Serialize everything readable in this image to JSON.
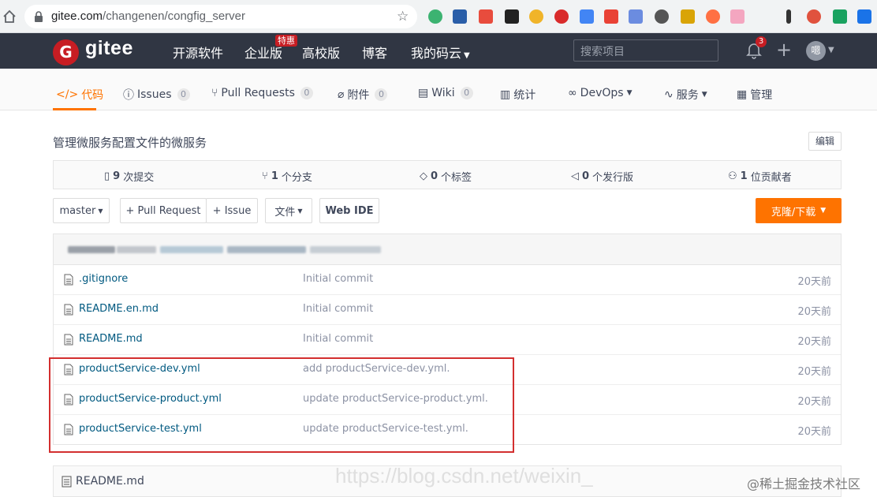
{
  "browser": {
    "url_host": "gitee.com",
    "url_path": "/changenen/congfig_server"
  },
  "header": {
    "logo_text": "gitee",
    "nav": [
      "开源软件",
      "企业版",
      "高校版",
      "博客",
      "我的码云"
    ],
    "hot_badge": "特惠",
    "search_placeholder": "搜索项目",
    "notification_count": "3",
    "avatar_text": "嗯"
  },
  "tabs": [
    {
      "label": "代码",
      "count": ""
    },
    {
      "label": "Issues",
      "count": "0"
    },
    {
      "label": "Pull Requests",
      "count": "0"
    },
    {
      "label": "附件",
      "count": "0"
    },
    {
      "label": "Wiki",
      "count": "0"
    },
    {
      "label": "统计",
      "count": ""
    },
    {
      "label": "DevOps",
      "count": ""
    },
    {
      "label": "服务",
      "count": ""
    },
    {
      "label": "管理",
      "count": ""
    }
  ],
  "repo": {
    "description": "管理微服务配置文件的微服务",
    "edit_label": "编辑"
  },
  "stats": [
    {
      "num": "9",
      "label": "次提交"
    },
    {
      "num": "1",
      "label": "个分支"
    },
    {
      "num": "0",
      "label": "个标签"
    },
    {
      "num": "0",
      "label": "个发行版"
    },
    {
      "num": "1",
      "label": "位贡献者"
    }
  ],
  "toolbar": {
    "branch": "master",
    "pull_request": "+ Pull Request",
    "issue": "+ Issue",
    "file": "文件",
    "web_ide": "Web IDE",
    "clone": "克隆/下载"
  },
  "files": [
    {
      "name": ".gitignore",
      "message": "Initial commit",
      "time": "20天前"
    },
    {
      "name": "README.en.md",
      "message": "Initial commit",
      "time": "20天前"
    },
    {
      "name": "README.md",
      "message": "Initial commit",
      "time": "20天前"
    },
    {
      "name": "productService-dev.yml",
      "message": "add productService-dev.yml.",
      "time": "20天前"
    },
    {
      "name": "productService-product.yml",
      "message": "update productService-product.yml.",
      "time": "20天前"
    },
    {
      "name": "productService-test.yml",
      "message": "update productService-test.yml.",
      "time": "20天前"
    }
  ],
  "readme": {
    "title": "README.md"
  },
  "watermark": "https://blog.csdn.net/weixin_",
  "site_mark": "@稀土掘金技术社区",
  "colors": {
    "accent": "#fe7300",
    "header_bg": "#303643",
    "brand_red": "#c71d23",
    "link": "#005980",
    "highlight_border": "#d32f2f"
  }
}
